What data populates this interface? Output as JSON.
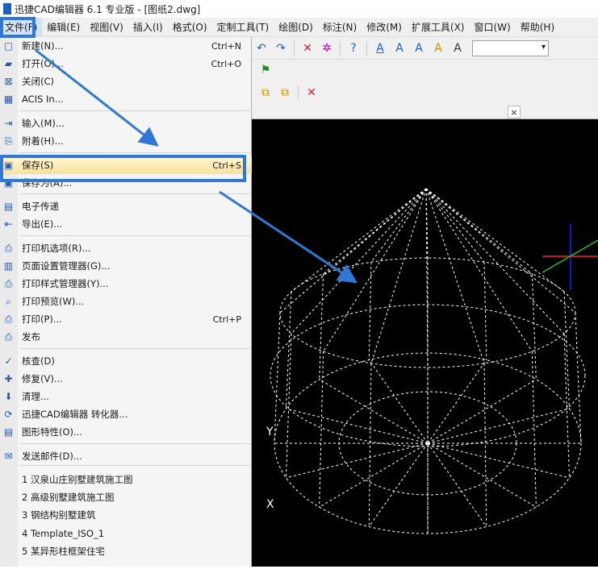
{
  "app": {
    "title": "迅捷CAD编辑器 6.1 专业版 - [图纸2.dwg]"
  },
  "menubar": {
    "items": [
      {
        "label": "文件(F)",
        "name": "menu-file",
        "active": true
      },
      {
        "label": "编辑(E)",
        "name": "menu-edit"
      },
      {
        "label": "视图(V)",
        "name": "menu-view"
      },
      {
        "label": "插入(I)",
        "name": "menu-insert"
      },
      {
        "label": "格式(O)",
        "name": "menu-format"
      },
      {
        "label": "定制工具(T)",
        "name": "menu-custom-tools"
      },
      {
        "label": "绘图(D)",
        "name": "menu-draw"
      },
      {
        "label": "标注(N)",
        "name": "menu-dimension"
      },
      {
        "label": "修改(M)",
        "name": "menu-modify"
      },
      {
        "label": "扩展工具(X)",
        "name": "menu-extend-tools"
      },
      {
        "label": "窗口(W)",
        "name": "menu-window"
      },
      {
        "label": "帮助(H)",
        "name": "menu-help"
      }
    ]
  },
  "toolbar": {
    "text_buttons": [
      "A",
      "A",
      "A",
      "A",
      "A"
    ],
    "combo_value": ""
  },
  "file_menu": {
    "items": [
      {
        "label": "新建(N)...",
        "shortcut": "Ctrl+N",
        "icon": "new-file-icon"
      },
      {
        "label": "打开(O)...",
        "shortcut": "Ctrl+O",
        "icon": "open-folder-icon"
      },
      {
        "label": "关闭(C)",
        "shortcut": "",
        "icon": "close-file-icon"
      },
      {
        "label": "ACIS In...",
        "shortcut": "",
        "icon": "acis-icon"
      },
      {
        "label": "输入(M)...",
        "shortcut": "",
        "icon": "import-icon"
      },
      {
        "label": "附着(H)...",
        "shortcut": "",
        "icon": "attach-icon"
      },
      {
        "label": "保存(S)",
        "shortcut": "Ctrl+S",
        "icon": "save-icon",
        "highlight": true
      },
      {
        "label": "保存为(A)...",
        "shortcut": "",
        "icon": "save-as-icon"
      },
      {
        "label": "电子传递",
        "shortcut": "",
        "icon": "etransmit-icon"
      },
      {
        "label": "导出(E)...",
        "shortcut": "",
        "icon": "export-icon"
      },
      {
        "label": "打印机选项(R)...",
        "shortcut": "",
        "icon": "printer-options-icon"
      },
      {
        "label": "页面设置管理器(G)...",
        "shortcut": "",
        "icon": "page-setup-icon"
      },
      {
        "label": "打印样式管理器(Y)...",
        "shortcut": "",
        "icon": "print-style-icon"
      },
      {
        "label": "打印预览(W)...",
        "shortcut": "",
        "icon": "print-preview-icon"
      },
      {
        "label": "打印(P)...",
        "shortcut": "Ctrl+P",
        "icon": "print-icon"
      },
      {
        "label": "发布",
        "shortcut": "",
        "icon": "publish-icon"
      },
      {
        "label": "核查(D)",
        "shortcut": "",
        "icon": "audit-icon"
      },
      {
        "label": "修复(V)...",
        "shortcut": "",
        "icon": "repair-icon"
      },
      {
        "label": "清理...",
        "shortcut": "",
        "icon": "purge-icon"
      },
      {
        "label": "迅捷CAD编辑器 转化器...",
        "shortcut": "",
        "icon": "converter-icon"
      },
      {
        "label": "图形特性(O)...",
        "shortcut": "",
        "icon": "drawing-properties-icon"
      },
      {
        "label": "发送邮件(D)...",
        "shortcut": "",
        "icon": "send-mail-icon"
      },
      {
        "label": "1 汉泉山庄别墅建筑施工图",
        "shortcut": "",
        "icon": ""
      },
      {
        "label": "2 高级别墅建筑施工图",
        "shortcut": "",
        "icon": ""
      },
      {
        "label": "3 钢结构别墅建筑",
        "shortcut": "",
        "icon": ""
      },
      {
        "label": "4 Template_ISO_1",
        "shortcut": "",
        "icon": ""
      },
      {
        "label": "5 某异形柱框架住宅",
        "shortcut": "",
        "icon": ""
      }
    ]
  },
  "drawing": {
    "tab_close": "×",
    "axis_x_label": "X",
    "axis_y_label": "Y"
  },
  "colors": {
    "accent": "#2f78d6",
    "canvas": "#000000",
    "highlight": "#fbe29a"
  }
}
